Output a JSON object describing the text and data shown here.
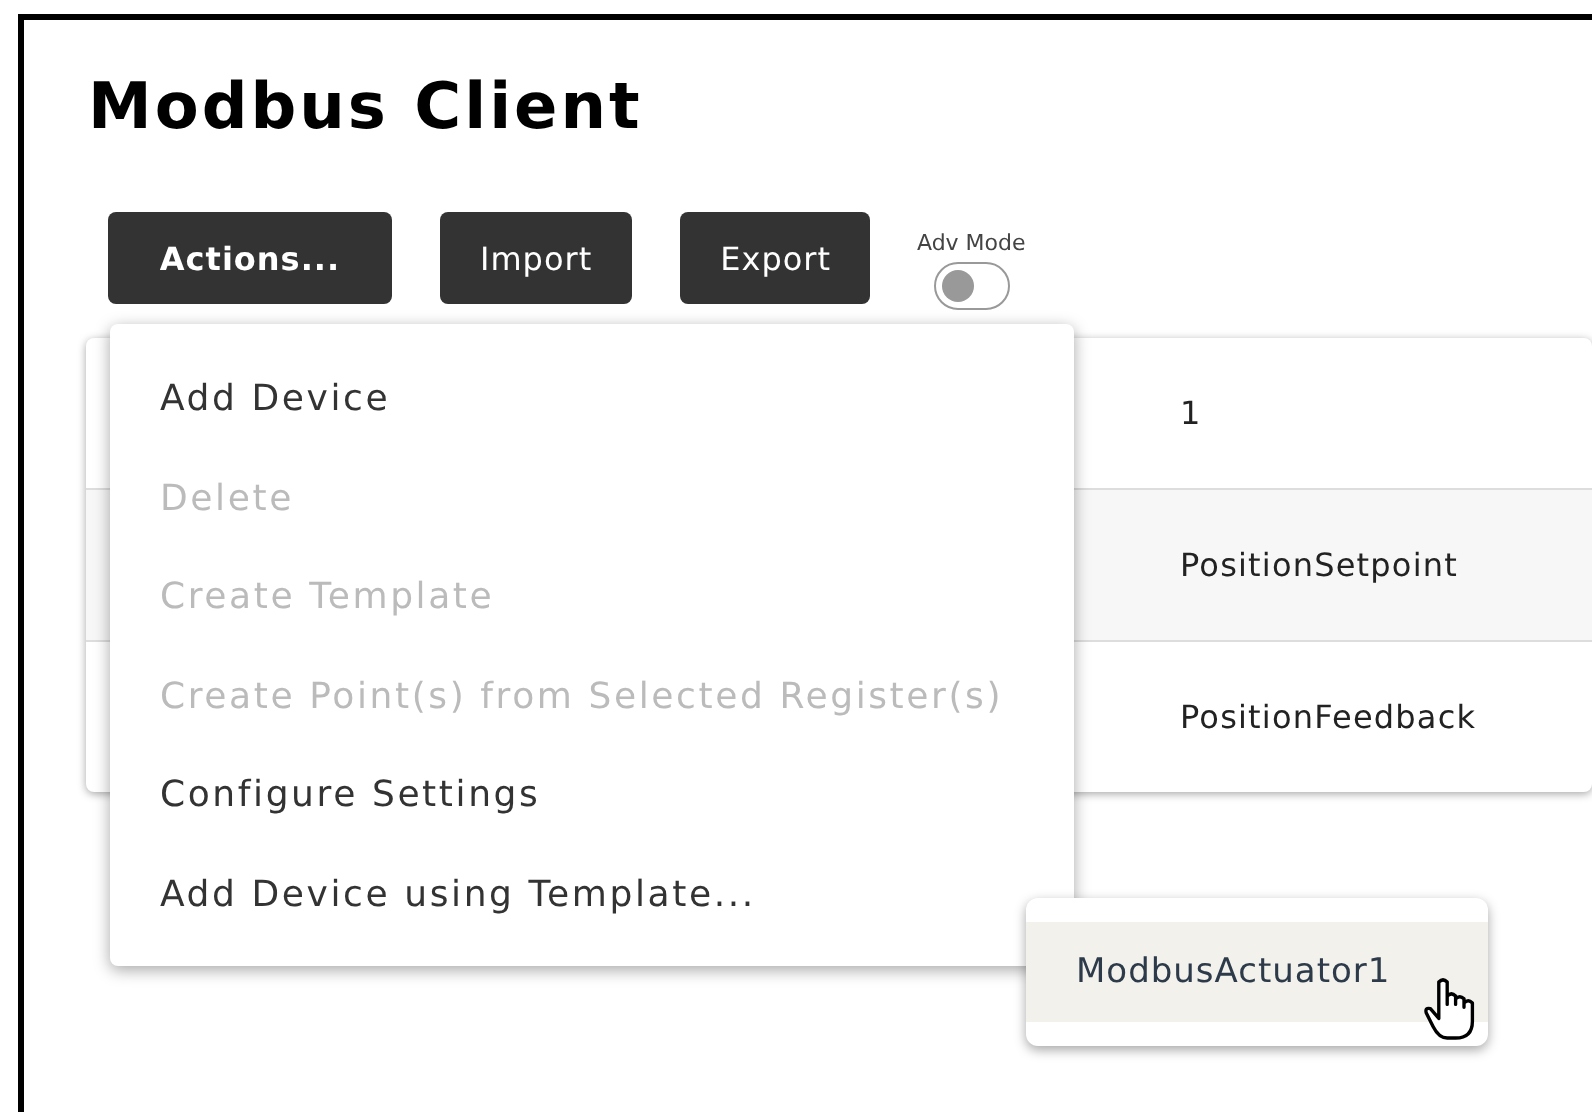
{
  "title": "Modbus Client",
  "toolbar": {
    "buttons": [
      {
        "label": "Actions...",
        "kind": "menu"
      },
      {
        "label": "Import",
        "kind": "plain"
      },
      {
        "label": "Export",
        "kind": "plain"
      }
    ],
    "adv_mode": {
      "label": "Adv Mode",
      "on": false
    }
  },
  "table": {
    "rows": [
      {
        "column_2": "1"
      },
      {
        "column_2": "PositionSetpoint"
      },
      {
        "column_2": "PositionFeedback"
      }
    ]
  },
  "actions_menu": {
    "items": [
      {
        "label": "Add Device",
        "disabled": false
      },
      {
        "label": "Delete",
        "disabled": true
      },
      {
        "label": "Create Template",
        "disabled": true
      },
      {
        "label": "Create Point(s) from Selected Register(s)",
        "disabled": true
      },
      {
        "label": "Configure Settings",
        "disabled": false
      },
      {
        "label": "Add Device using Template...",
        "disabled": false
      }
    ]
  },
  "template_submenu": {
    "items": [
      {
        "label": "ModbusActuator1",
        "selected": true
      }
    ]
  }
}
